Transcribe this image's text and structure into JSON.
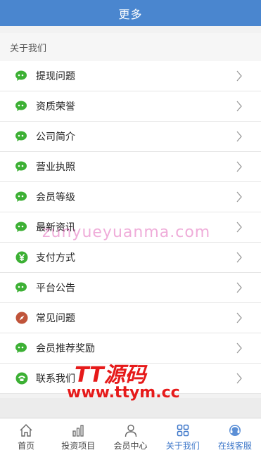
{
  "header": {
    "title": "更多"
  },
  "section": {
    "title": "关于我们"
  },
  "items": [
    {
      "label": "提现问题",
      "icon": "wechat-bubble-icon",
      "color": "#3cb034"
    },
    {
      "label": "资质荣誉",
      "icon": "wechat-bubble-icon",
      "color": "#3cb034"
    },
    {
      "label": "公司简介",
      "icon": "wechat-bubble-icon",
      "color": "#3cb034"
    },
    {
      "label": "营业执照",
      "icon": "wechat-bubble-icon",
      "color": "#3cb034"
    },
    {
      "label": "会员等级",
      "icon": "wechat-bubble-icon",
      "color": "#3cb034"
    },
    {
      "label": "最新资讯",
      "icon": "wechat-bubble-icon",
      "color": "#3cb034"
    },
    {
      "label": "支付方式",
      "icon": "yen-circle-icon",
      "color": "#3cb034"
    },
    {
      "label": "平台公告",
      "icon": "wechat-bubble-icon",
      "color": "#3cb034"
    },
    {
      "label": "常见问题",
      "icon": "compass-icon",
      "color": "#c0543a"
    },
    {
      "label": "会员推荐奖励",
      "icon": "wechat-bubble-icon",
      "color": "#3cb034"
    },
    {
      "label": "联系我们",
      "icon": "phone-icon",
      "color": "#3cb034"
    }
  ],
  "tabbar": [
    {
      "label": "首页",
      "icon": "home-icon",
      "active": false
    },
    {
      "label": "投资项目",
      "icon": "bar-chart-icon",
      "active": false
    },
    {
      "label": "会员中心",
      "icon": "user-icon",
      "active": false
    },
    {
      "label": "关于我们",
      "icon": "grid-icon",
      "active": true
    },
    {
      "label": "在线客服",
      "icon": "headset-icon",
      "active": true
    }
  ],
  "watermark": {
    "line1": "zunyueyuanma.com",
    "line2": "TT源码",
    "line3": "www.ttym.cc"
  },
  "colors": {
    "header_bg": "#4a86cf",
    "active_tab": "#3d77c9",
    "green": "#3cb034"
  }
}
